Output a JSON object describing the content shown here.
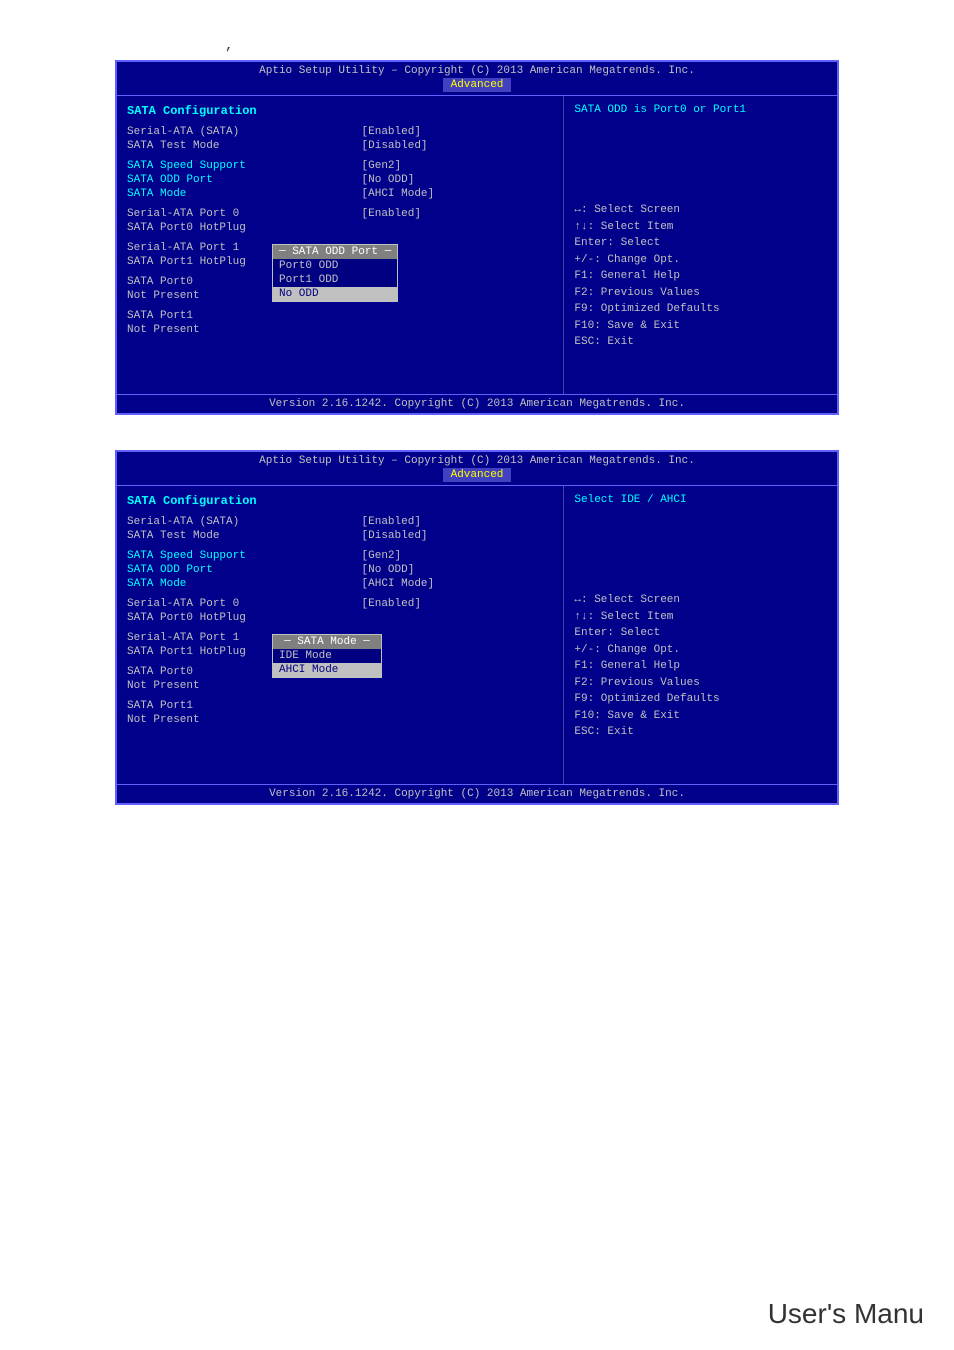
{
  "page": {
    "comma": ",",
    "users_manu": "User's Manu"
  },
  "screen1": {
    "titlebar": "Aptio Setup Utility – Copyright (C) 2013 American Megatrends. Inc.",
    "tab": "Advanced",
    "footer": "Version 2.16.1242. Copyright (C) 2013 American Megatrends. Inc.",
    "section_title": "SATA Configuration",
    "help_text": "SATA ODD is Port0 or Port1",
    "rows": [
      {
        "label": "Serial-ATA (SATA)",
        "value": "[Enabled]",
        "cyan": false
      },
      {
        "label": "SATA Test Mode",
        "value": "[Disabled]",
        "cyan": false
      },
      {
        "spacer": true
      },
      {
        "label": "SATA Speed Support",
        "value": "[Gen2]",
        "cyan": true
      },
      {
        "label": "SATA ODD Port",
        "value": "[No ODD]",
        "cyan": true
      },
      {
        "label": "SATA Mode",
        "value": "[AHCI Mode]",
        "cyan": true
      },
      {
        "spacer": true
      },
      {
        "label": "Serial-ATA Port 0",
        "value": "[Enabled]",
        "cyan": false
      },
      {
        "label": "SATA Port0 HotPlug",
        "value": "",
        "cyan": false
      },
      {
        "spacer": true
      },
      {
        "label": "Serial-ATA Port 1",
        "value": "",
        "cyan": false
      },
      {
        "label": "SATA Port1 HotPlug",
        "value": "",
        "cyan": false
      },
      {
        "spacer": true
      },
      {
        "label": "SATA Port0",
        "value": "",
        "cyan": false
      },
      {
        "label": "Not Present",
        "value": "",
        "cyan": false
      },
      {
        "spacer": true
      },
      {
        "label": "SATA Port1",
        "value": "",
        "cyan": false
      },
      {
        "label": "Not Present",
        "value": "",
        "cyan": false
      }
    ],
    "dropdown": {
      "title": "SATA ODD Port",
      "items": [
        {
          "label": "Port0 ODD",
          "selected": false
        },
        {
          "label": "Port1 ODD",
          "selected": false
        },
        {
          "label": "No ODD",
          "selected": true
        }
      ]
    },
    "key_hints": [
      "↔: Select Screen",
      "↑↓: Select Item",
      "Enter: Select",
      "+/-: Change Opt.",
      "F1: General Help",
      "F2: Previous Values",
      "F9: Optimized Defaults",
      "F10: Save & Exit",
      "ESC: Exit"
    ]
  },
  "screen2": {
    "titlebar": "Aptio Setup Utility – Copyright (C) 2013 American Megatrends. Inc.",
    "tab": "Advanced",
    "footer": "Version 2.16.1242. Copyright (C) 2013 American Megatrends. Inc.",
    "section_title": "SATA Configuration",
    "help_text": "Select IDE / AHCI",
    "rows": [
      {
        "label": "Serial-ATA (SATA)",
        "value": "[Enabled]",
        "cyan": false
      },
      {
        "label": "SATA Test Mode",
        "value": "[Disabled]",
        "cyan": false
      },
      {
        "spacer": true
      },
      {
        "label": "SATA Speed Support",
        "value": "[Gen2]",
        "cyan": true
      },
      {
        "label": "SATA ODD Port",
        "value": "[No ODD]",
        "cyan": true
      },
      {
        "label": "SATA Mode",
        "value": "[AHCI Mode]",
        "cyan": true
      },
      {
        "spacer": true
      },
      {
        "label": "Serial-ATA Port 0",
        "value": "[Enabled]",
        "cyan": false
      },
      {
        "label": "SATA Port0 HotPlug",
        "value": "",
        "cyan": false
      },
      {
        "spacer": true
      },
      {
        "label": "Serial-ATA Port 1",
        "value": "",
        "cyan": false
      },
      {
        "label": "SATA Port1 HotPlug",
        "value": "",
        "cyan": false
      },
      {
        "spacer": true
      },
      {
        "label": "SATA Port0",
        "value": "",
        "cyan": false
      },
      {
        "label": "Not Present",
        "value": "",
        "cyan": false
      },
      {
        "spacer": true
      },
      {
        "label": "SATA Port1",
        "value": "",
        "cyan": false
      },
      {
        "label": "Not Present",
        "value": "",
        "cyan": false
      }
    ],
    "dropdown": {
      "title": "SATA Mode",
      "items": [
        {
          "label": "IDE Mode",
          "selected": false
        },
        {
          "label": "AHCI Mode",
          "selected": true
        }
      ]
    },
    "key_hints": [
      "↔: Select Screen",
      "↑↓: Select Item",
      "Enter: Select",
      "+/-: Change Opt.",
      "F1: General Help",
      "F2: Previous Values",
      "F9: Optimized Defaults",
      "F10: Save & Exit",
      "ESC: Exit"
    ]
  }
}
